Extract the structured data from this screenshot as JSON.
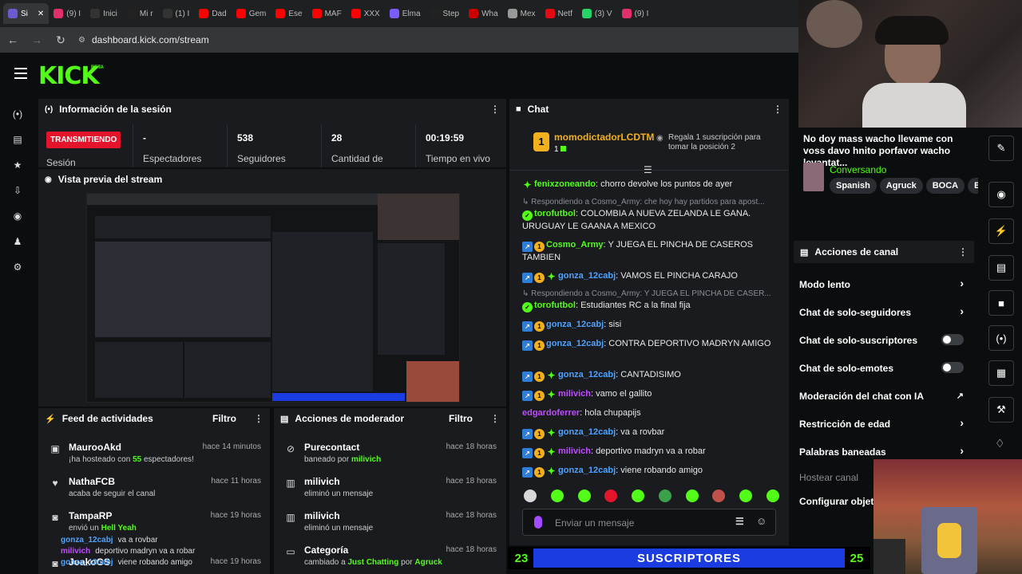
{
  "browser": {
    "tabs": [
      {
        "label": "Si",
        "color": "#6a5acd",
        "active": true
      },
      {
        "label": "(9) I",
        "color": "#e1306c"
      },
      {
        "label": "Inici",
        "color": "#333"
      },
      {
        "label": "Mi r",
        "color": "#222"
      },
      {
        "label": "(1) I",
        "color": "#333"
      },
      {
        "label": "Dad",
        "color": "#ff0000"
      },
      {
        "label": "Gem",
        "color": "#ff0000"
      },
      {
        "label": "Ese",
        "color": "#ff0000"
      },
      {
        "label": "MAF",
        "color": "#ff0000"
      },
      {
        "label": "XXX",
        "color": "#ff0000"
      },
      {
        "label": "Elma",
        "color": "#7b5cff"
      },
      {
        "label": "Step",
        "color": "#222"
      },
      {
        "label": "Wha",
        "color": "#cc0000"
      },
      {
        "label": "Mex",
        "color": "#999"
      },
      {
        "label": "Netf",
        "color": "#e50914"
      },
      {
        "label": "(3) V",
        "color": "#25d366"
      },
      {
        "label": "(9) I",
        "color": "#e1306c"
      }
    ],
    "url": "dashboard.kick.com/stream"
  },
  "kick": {
    "logo": "KICK",
    "beta": "BETA"
  },
  "session": {
    "title": "Información de la sesión",
    "live_label": "TRANSMITIENDO",
    "sesion_label": "Sesión",
    "stats": [
      {
        "value": "-",
        "label": "Espectadores"
      },
      {
        "value": "538",
        "label": "Seguidores"
      },
      {
        "value": "28",
        "label": "Cantidad de"
      },
      {
        "value": "00:19:59",
        "label": "Tiempo en vivo"
      }
    ]
  },
  "preview": {
    "title": "Vista previa del stream"
  },
  "feed": {
    "title": "Feed de actividades",
    "filter": "Filtro",
    "items": [
      {
        "name": "MaurooAkd",
        "time": "hace 14 minutos",
        "sub_pre": "¡ha hosteado con ",
        "sub_hl": "55",
        "sub_post": " espectadores!",
        "icon": "host-icon"
      },
      {
        "name": "NathaFCB",
        "time": "hace 11 horas",
        "sub_pre": "acaba de seguir el canal",
        "sub_hl": "",
        "sub_post": "",
        "icon": "heart-icon"
      },
      {
        "name": "TampaRP",
        "time": "hace 19 horas",
        "sub_pre": "envió un ",
        "sub_hl": "Hell Yeah",
        "sub_post": "",
        "icon": "kick-icon"
      },
      {
        "name": "JoakoGS",
        "time": "hace 19 horas",
        "sub_pre": "",
        "sub_hl": "",
        "sub_post": "",
        "icon": "kick-icon"
      }
    ],
    "overlay_lines": [
      {
        "user": "gonza_12cabj",
        "text": "va a rovbar"
      },
      {
        "user": "milivich",
        "text": "deportivo madryn va a robar"
      },
      {
        "user": "gonza_12cabj",
        "text": "viene robando amigo"
      }
    ]
  },
  "mod": {
    "title": "Acciones de moderador",
    "filter": "Filtro",
    "items": [
      {
        "name": "Purecontact",
        "time": "hace 18 horas",
        "sub_pre": "baneado por ",
        "sub_hl": "milivich",
        "sub_post": "",
        "icon": "ban-icon"
      },
      {
        "name": "milivich",
        "time": "hace 18 horas",
        "sub_pre": "eliminó un mensaje",
        "sub_hl": "",
        "sub_post": "",
        "icon": "trash-icon"
      },
      {
        "name": "milivich",
        "time": "hace 18 horas",
        "sub_pre": "eliminó un mensaje",
        "sub_hl": "",
        "sub_post": "",
        "icon": "trash-icon"
      },
      {
        "name": "Categoría",
        "time": "hace 18 horas",
        "sub_pre": "cambiado a ",
        "sub_hl": "Just Chatting",
        "sub_post": " por ",
        "sub_hl2": "Agruck",
        "icon": "category-icon"
      }
    ]
  },
  "chat": {
    "title": "Chat",
    "pinned": {
      "user": "momodictadorLCDTM",
      "sub": "1",
      "gift_text": "Regala 1 suscripción para tomar la posición 2"
    },
    "messages": [
      {
        "kind": "msg",
        "badges": [
          "green"
        ],
        "user": "fenixzoneando",
        "color": "#53fc18",
        "text": "chorro devolve los puntos de ayer"
      },
      {
        "kind": "reply",
        "text": "Respondiendo a Cosmo_Army: che hoy hay partidos para apost..."
      },
      {
        "kind": "msg",
        "badges": [
          "verified"
        ],
        "user": "torofutbol",
        "color": "#53fc18",
        "text": "COLOMBIA A NUEVA ZELANDA LE GANA. URUGUAY LE GAANA A MEXICO"
      },
      {
        "kind": "msg",
        "badges": [
          "blue",
          "gold"
        ],
        "user": "Cosmo_Army",
        "color": "#53fc18",
        "text": "Y JUEGA EL PINCHA DE CASEROS TAMBIEN"
      },
      {
        "kind": "msg",
        "badges": [
          "blue",
          "gold",
          "green"
        ],
        "user": "gonza_12cabj",
        "color": "#4ea3ff",
        "text": "VAMOS EL PINCHA CARAJO"
      },
      {
        "kind": "reply",
        "text": "Respondiendo a Cosmo_Army: Y JUEGA EL PINCHA DE CASER..."
      },
      {
        "kind": "msg",
        "badges": [
          "verified"
        ],
        "user": "torofutbol",
        "color": "#53fc18",
        "text": "Estudiantes RC a la final fija"
      },
      {
        "kind": "msg",
        "badges": [
          "blue",
          "gold"
        ],
        "user": "gonza_12cabj",
        "color": "#4ea3ff",
        "text": "sisi"
      },
      {
        "kind": "msg",
        "badges": [
          "blue",
          "gold"
        ],
        "user": "gonza_12cabj",
        "color": "#4ea3ff",
        "text": "CONTRA DEPORTIVO MADRYN AMIGO"
      },
      {
        "kind": "msg",
        "badges": [
          "blue",
          "gold",
          "green"
        ],
        "user": "gonza_12cabj",
        "color": "#4ea3ff",
        "text": "CANTADISIMO"
      },
      {
        "kind": "msg",
        "badges": [
          "blue",
          "gold",
          "green"
        ],
        "user": "milivich",
        "color": "#c04bff",
        "text": "vamo el gallito"
      },
      {
        "kind": "msg",
        "badges": [],
        "user": "edgardoferrer",
        "color": "#c04bff",
        "text": "hola chupapijs"
      },
      {
        "kind": "msg",
        "badges": [
          "blue",
          "gold",
          "green"
        ],
        "user": "gonza_12cabj",
        "color": "#4ea3ff",
        "text": "va a rovbar"
      },
      {
        "kind": "msg",
        "badges": [
          "blue",
          "gold",
          "green"
        ],
        "user": "milivich",
        "color": "#c04bff",
        "text": "deportivo madryn va a robar"
      },
      {
        "kind": "msg",
        "badges": [
          "blue",
          "gold",
          "green"
        ],
        "user": "gonza_12cabj",
        "color": "#4ea3ff",
        "text": "viene robando amigo"
      }
    ],
    "input_placeholder": "Enviar un mensaje"
  },
  "subgoal": {
    "current": "23",
    "label": "SUSCRIPTORES",
    "target": "25"
  },
  "stream_info": {
    "title": "No doy mass wacho llevame con voss davo hnito porfavor wacho levantat...",
    "category": "Conversando",
    "tags": [
      "Spanish",
      "Agruck",
      "BOCA",
      "BC"
    ]
  },
  "channel_actions": {
    "title": "Acciones de canal",
    "items": [
      {
        "label": "Modo lento",
        "control": "chevron"
      },
      {
        "label": "Chat de solo-seguidores",
        "control": "chevron"
      },
      {
        "label": "Chat de solo-suscriptores",
        "control": "toggle"
      },
      {
        "label": "Chat de solo-emotes",
        "control": "toggle"
      },
      {
        "label": "Moderación del chat con IA",
        "control": "external"
      },
      {
        "label": "Restricción de edad",
        "control": "chevron"
      },
      {
        "label": "Palabras baneadas",
        "control": "chevron"
      },
      {
        "label": "Hostear canal",
        "control": "none"
      },
      {
        "label": "Configurar objetiv",
        "control": "none"
      }
    ]
  },
  "colors": {
    "kick_green": "#53fc18",
    "live_red": "#e3142b",
    "sub_blue": "#1a3ce0",
    "panel": "#191b1f"
  }
}
